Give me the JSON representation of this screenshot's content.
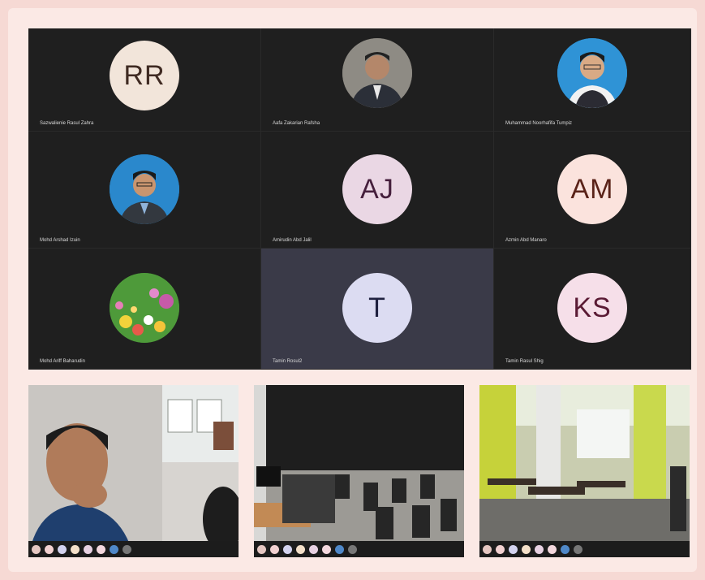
{
  "participants": [
    {
      "initials": "RR",
      "name": "Sazwalienie Rasul Zahra",
      "style": "av-rr"
    },
    {
      "initials": "",
      "name": "Aafa Zakarian Rafsha",
      "style": "photo-suit"
    },
    {
      "initials": "",
      "name": "Muhammad Noorhafifa Tumpiz",
      "style": "photo-blue"
    },
    {
      "initials": "",
      "name": "Mohd Arshad Izuin",
      "style": "photo-blue2"
    },
    {
      "initials": "AJ",
      "name": "Amirudin Abd Jalil",
      "style": "av-aj"
    },
    {
      "initials": "AM",
      "name": "Azmin Abd Manaro",
      "style": "av-am"
    },
    {
      "initials": "",
      "name": "Mohd Ariff Baharudin",
      "style": "photo-flowers"
    },
    {
      "initials": "T",
      "name": "Tamin Rosul2",
      "style": "av-t"
    },
    {
      "initials": "KS",
      "name": "Tamin Rasul Shig",
      "style": "av-ks"
    }
  ],
  "screenshots": [
    {
      "label": "video-call-presenter"
    },
    {
      "label": "empty-classroom"
    },
    {
      "label": "workshop-floor"
    }
  ]
}
